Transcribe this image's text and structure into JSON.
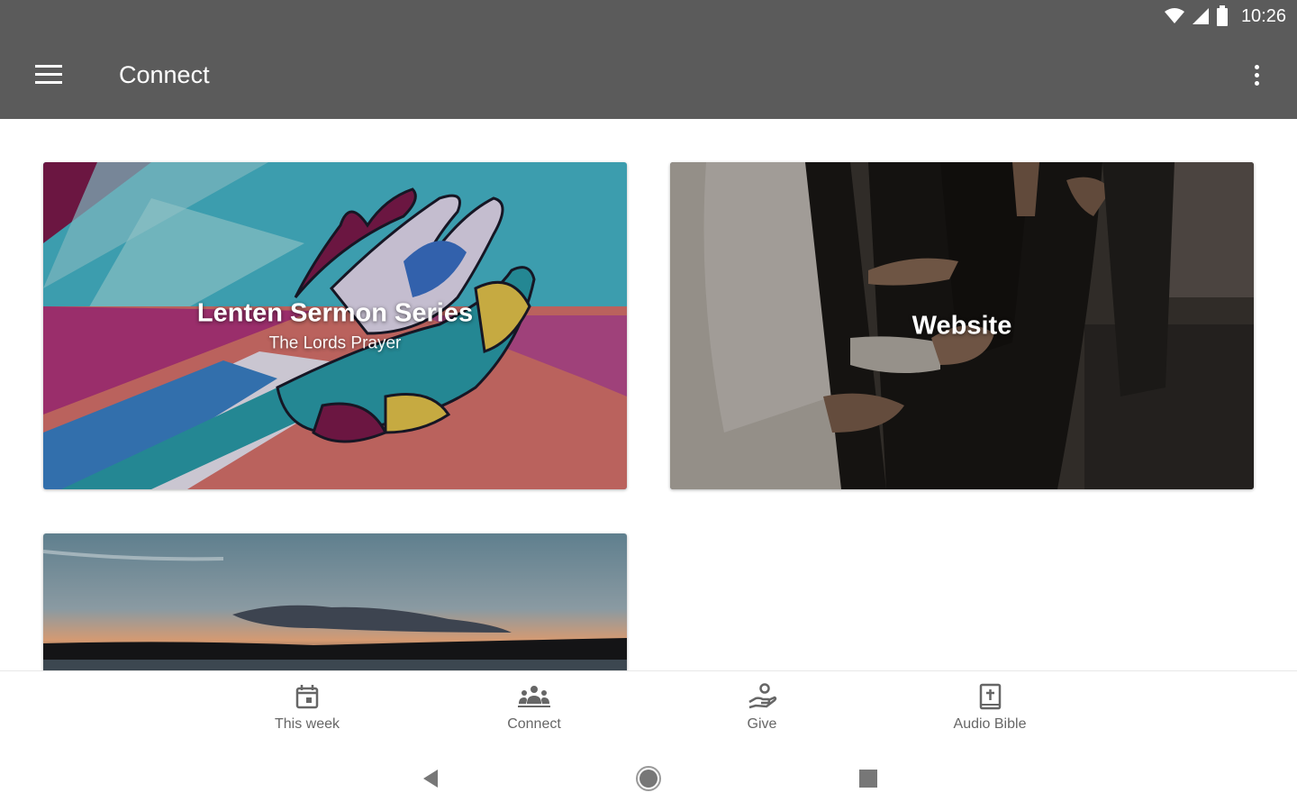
{
  "status_bar": {
    "time": "10:26"
  },
  "app_bar": {
    "title": "Connect"
  },
  "cards": [
    {
      "title": "Lenten Sermon Series",
      "subtitle": "The Lords Prayer"
    },
    {
      "title": "Website"
    },
    {
      "title": ""
    }
  ],
  "bottom_nav": {
    "items": [
      {
        "label": "This week",
        "icon": "calendar-icon"
      },
      {
        "label": "Connect",
        "icon": "group-icon"
      },
      {
        "label": "Give",
        "icon": "give-hand-icon"
      },
      {
        "label": "Audio Bible",
        "icon": "bible-icon"
      }
    ]
  },
  "colors": {
    "app_bar": "#5b5b5b",
    "nav_icon": "#666666"
  }
}
